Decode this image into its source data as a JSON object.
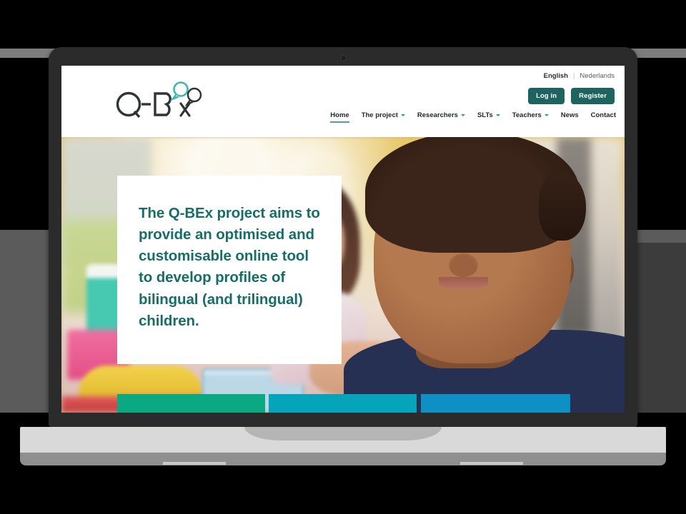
{
  "device": {
    "type": "laptop",
    "webcam": "webcam-dot"
  },
  "site": {
    "logo": {
      "text": "Q-BEx",
      "alt": "Q-BEx logo with speech bubbles"
    },
    "language": {
      "active": "English",
      "separator": "|",
      "alternate": "Nederlands"
    },
    "auth": {
      "login_label": "Log in",
      "register_label": "Register"
    },
    "nav": [
      {
        "label": "Home",
        "has_dropdown": false,
        "active": true
      },
      {
        "label": "The project",
        "has_dropdown": true,
        "active": false
      },
      {
        "label": "Researchers",
        "has_dropdown": true,
        "active": false
      },
      {
        "label": "SLTs",
        "has_dropdown": true,
        "active": false
      },
      {
        "label": "Teachers",
        "has_dropdown": true,
        "active": false
      },
      {
        "label": "News",
        "has_dropdown": false,
        "active": false
      },
      {
        "label": "Contact",
        "has_dropdown": false,
        "active": false
      }
    ]
  },
  "hero": {
    "headline": "The Q-BEx project aims to provide an optimised and customisable online tool to develop profiles of bilingual (and trilingual) children.",
    "image_description": "Smiling child in navy striped polo shirt in a blurred classroom",
    "bars": [
      {
        "name": "bar-green",
        "color": "#0aa883"
      },
      {
        "name": "bar-teal",
        "color": "#05a4bb"
      },
      {
        "name": "bar-blue",
        "color": "#0e90c4"
      }
    ]
  },
  "colors": {
    "brand_teal": "#1d6460",
    "headline_teal": "#176e69",
    "nav_underline": "#5d9894",
    "bezel": "#2b2b2b",
    "deck": "#d9d9d9",
    "page_background": "#000000"
  }
}
